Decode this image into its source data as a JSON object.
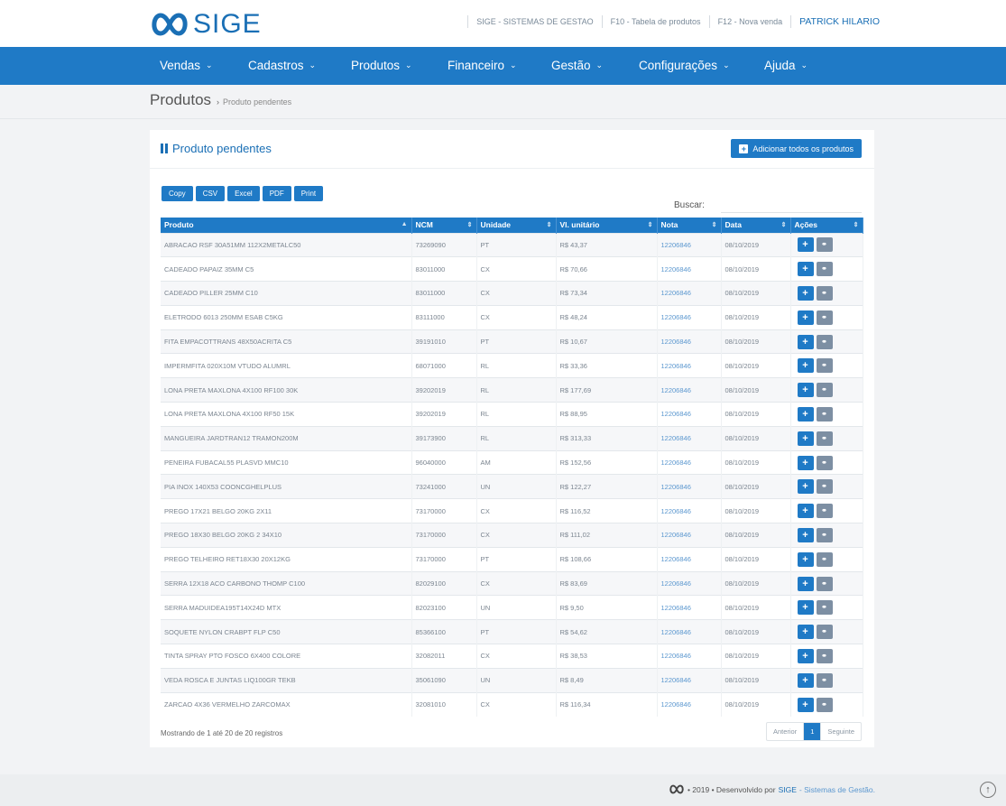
{
  "header": {
    "logo_text": "SIGE",
    "links": [
      "SIGE - SISTEMAS DE GESTAO",
      "F10 - Tabela de produtos",
      "F12 - Nova venda"
    ],
    "user": "PATRICK HILARIO"
  },
  "nav": {
    "items": [
      {
        "label": "Vendas"
      },
      {
        "label": "Cadastros"
      },
      {
        "label": "Produtos"
      },
      {
        "label": "Financeiro"
      },
      {
        "label": "Gestão"
      },
      {
        "label": "Configurações"
      },
      {
        "label": "Ajuda"
      }
    ]
  },
  "breadcrumb": {
    "title": "Produtos",
    "sep": "›",
    "current": "Produto pendentes"
  },
  "panel": {
    "title": "Produto pendentes",
    "add_all_label": "Adicionar todos os produtos",
    "export_buttons": [
      "Copy",
      "CSV",
      "Excel",
      "PDF",
      "Print"
    ],
    "search_label": "Buscar:",
    "search_value": ""
  },
  "table": {
    "columns": [
      "Produto",
      "NCM",
      "Unidade",
      "Vl. unitário",
      "Nota",
      "Data",
      "Ações"
    ],
    "rows": [
      [
        "ABRACAO RSF 30A51MM 112X2METALC50",
        "73269090",
        "PT",
        "R$ 43,37",
        "12206846",
        "08/10/2019"
      ],
      [
        "CADEADO PAPAIZ 35MM C5",
        "83011000",
        "CX",
        "R$ 70,66",
        "12206846",
        "08/10/2019"
      ],
      [
        "CADEADO PILLER 25MM C10",
        "83011000",
        "CX",
        "R$ 73,34",
        "12206846",
        "08/10/2019"
      ],
      [
        "ELETRODO 6013 250MM ESAB C5KG",
        "83111000",
        "CX",
        "R$ 48,24",
        "12206846",
        "08/10/2019"
      ],
      [
        "FITA EMPACOTTRANS 48X50ACRITA C5",
        "39191010",
        "PT",
        "R$ 10,67",
        "12206846",
        "08/10/2019"
      ],
      [
        "IMPERMFITA 020X10M VTUDO ALUMRL",
        "68071000",
        "RL",
        "R$ 33,36",
        "12206846",
        "08/10/2019"
      ],
      [
        "LONA PRETA MAXLONA 4X100 RF100 30K",
        "39202019",
        "RL",
        "R$ 177,69",
        "12206846",
        "08/10/2019"
      ],
      [
        "LONA PRETA MAXLONA 4X100 RF50 15K",
        "39202019",
        "RL",
        "R$ 88,95",
        "12206846",
        "08/10/2019"
      ],
      [
        "MANGUEIRA JARDTRAN12 TRAMON200M",
        "39173900",
        "RL",
        "R$ 313,33",
        "12206846",
        "08/10/2019"
      ],
      [
        "PENEIRA FUBACAL55 PLASVD MMC10",
        "96040000",
        "AM",
        "R$ 152,56",
        "12206846",
        "08/10/2019"
      ],
      [
        "PIA INOX 140X53 COONCGHELPLUS",
        "73241000",
        "UN",
        "R$ 122,27",
        "12206846",
        "08/10/2019"
      ],
      [
        "PREGO 17X21 BELGO 20KG 2X11",
        "73170000",
        "CX",
        "R$ 116,52",
        "12206846",
        "08/10/2019"
      ],
      [
        "PREGO 18X30 BELGO 20KG 2 34X10",
        "73170000",
        "CX",
        "R$ 111,02",
        "12206846",
        "08/10/2019"
      ],
      [
        "PREGO TELHEIRO RET18X30 20X12KG",
        "73170000",
        "PT",
        "R$ 108,66",
        "12206846",
        "08/10/2019"
      ],
      [
        "SERRA 12X18 ACO CARBONO THOMP C100",
        "82029100",
        "CX",
        "R$ 83,69",
        "12206846",
        "08/10/2019"
      ],
      [
        "SERRA MADUIDEA195T14X24D MTX",
        "82023100",
        "UN",
        "R$ 9,50",
        "12206846",
        "08/10/2019"
      ],
      [
        "SOQUETE NYLON CRABPT FLP C50",
        "85366100",
        "PT",
        "R$ 54,62",
        "12206846",
        "08/10/2019"
      ],
      [
        "TINTA SPRAY PTO FOSCO 6X400 COLORE",
        "32082011",
        "CX",
        "R$ 38,53",
        "12206846",
        "08/10/2019"
      ],
      [
        "VEDA ROSCA E JUNTAS LIQ100GR TEKB",
        "35061090",
        "UN",
        "R$ 8,49",
        "12206846",
        "08/10/2019"
      ],
      [
        "ZARCAO 4X36 VERMELHO ZARCOMAX",
        "32081010",
        "CX",
        "R$ 116,34",
        "12206846",
        "08/10/2019"
      ]
    ]
  },
  "info": "Mostrando de 1 até 20 de 20 registros",
  "pager": {
    "prev": "Anterior",
    "current": "1",
    "next": "Seguinte"
  },
  "footer": {
    "year_text": "• 2019 • Desenvolvido por",
    "brand": "SIGE",
    "suffix": "- Sistemas de Gestão."
  },
  "colors": {
    "primary": "#1f7ac6",
    "secondary_action": "#7d8fa3"
  }
}
